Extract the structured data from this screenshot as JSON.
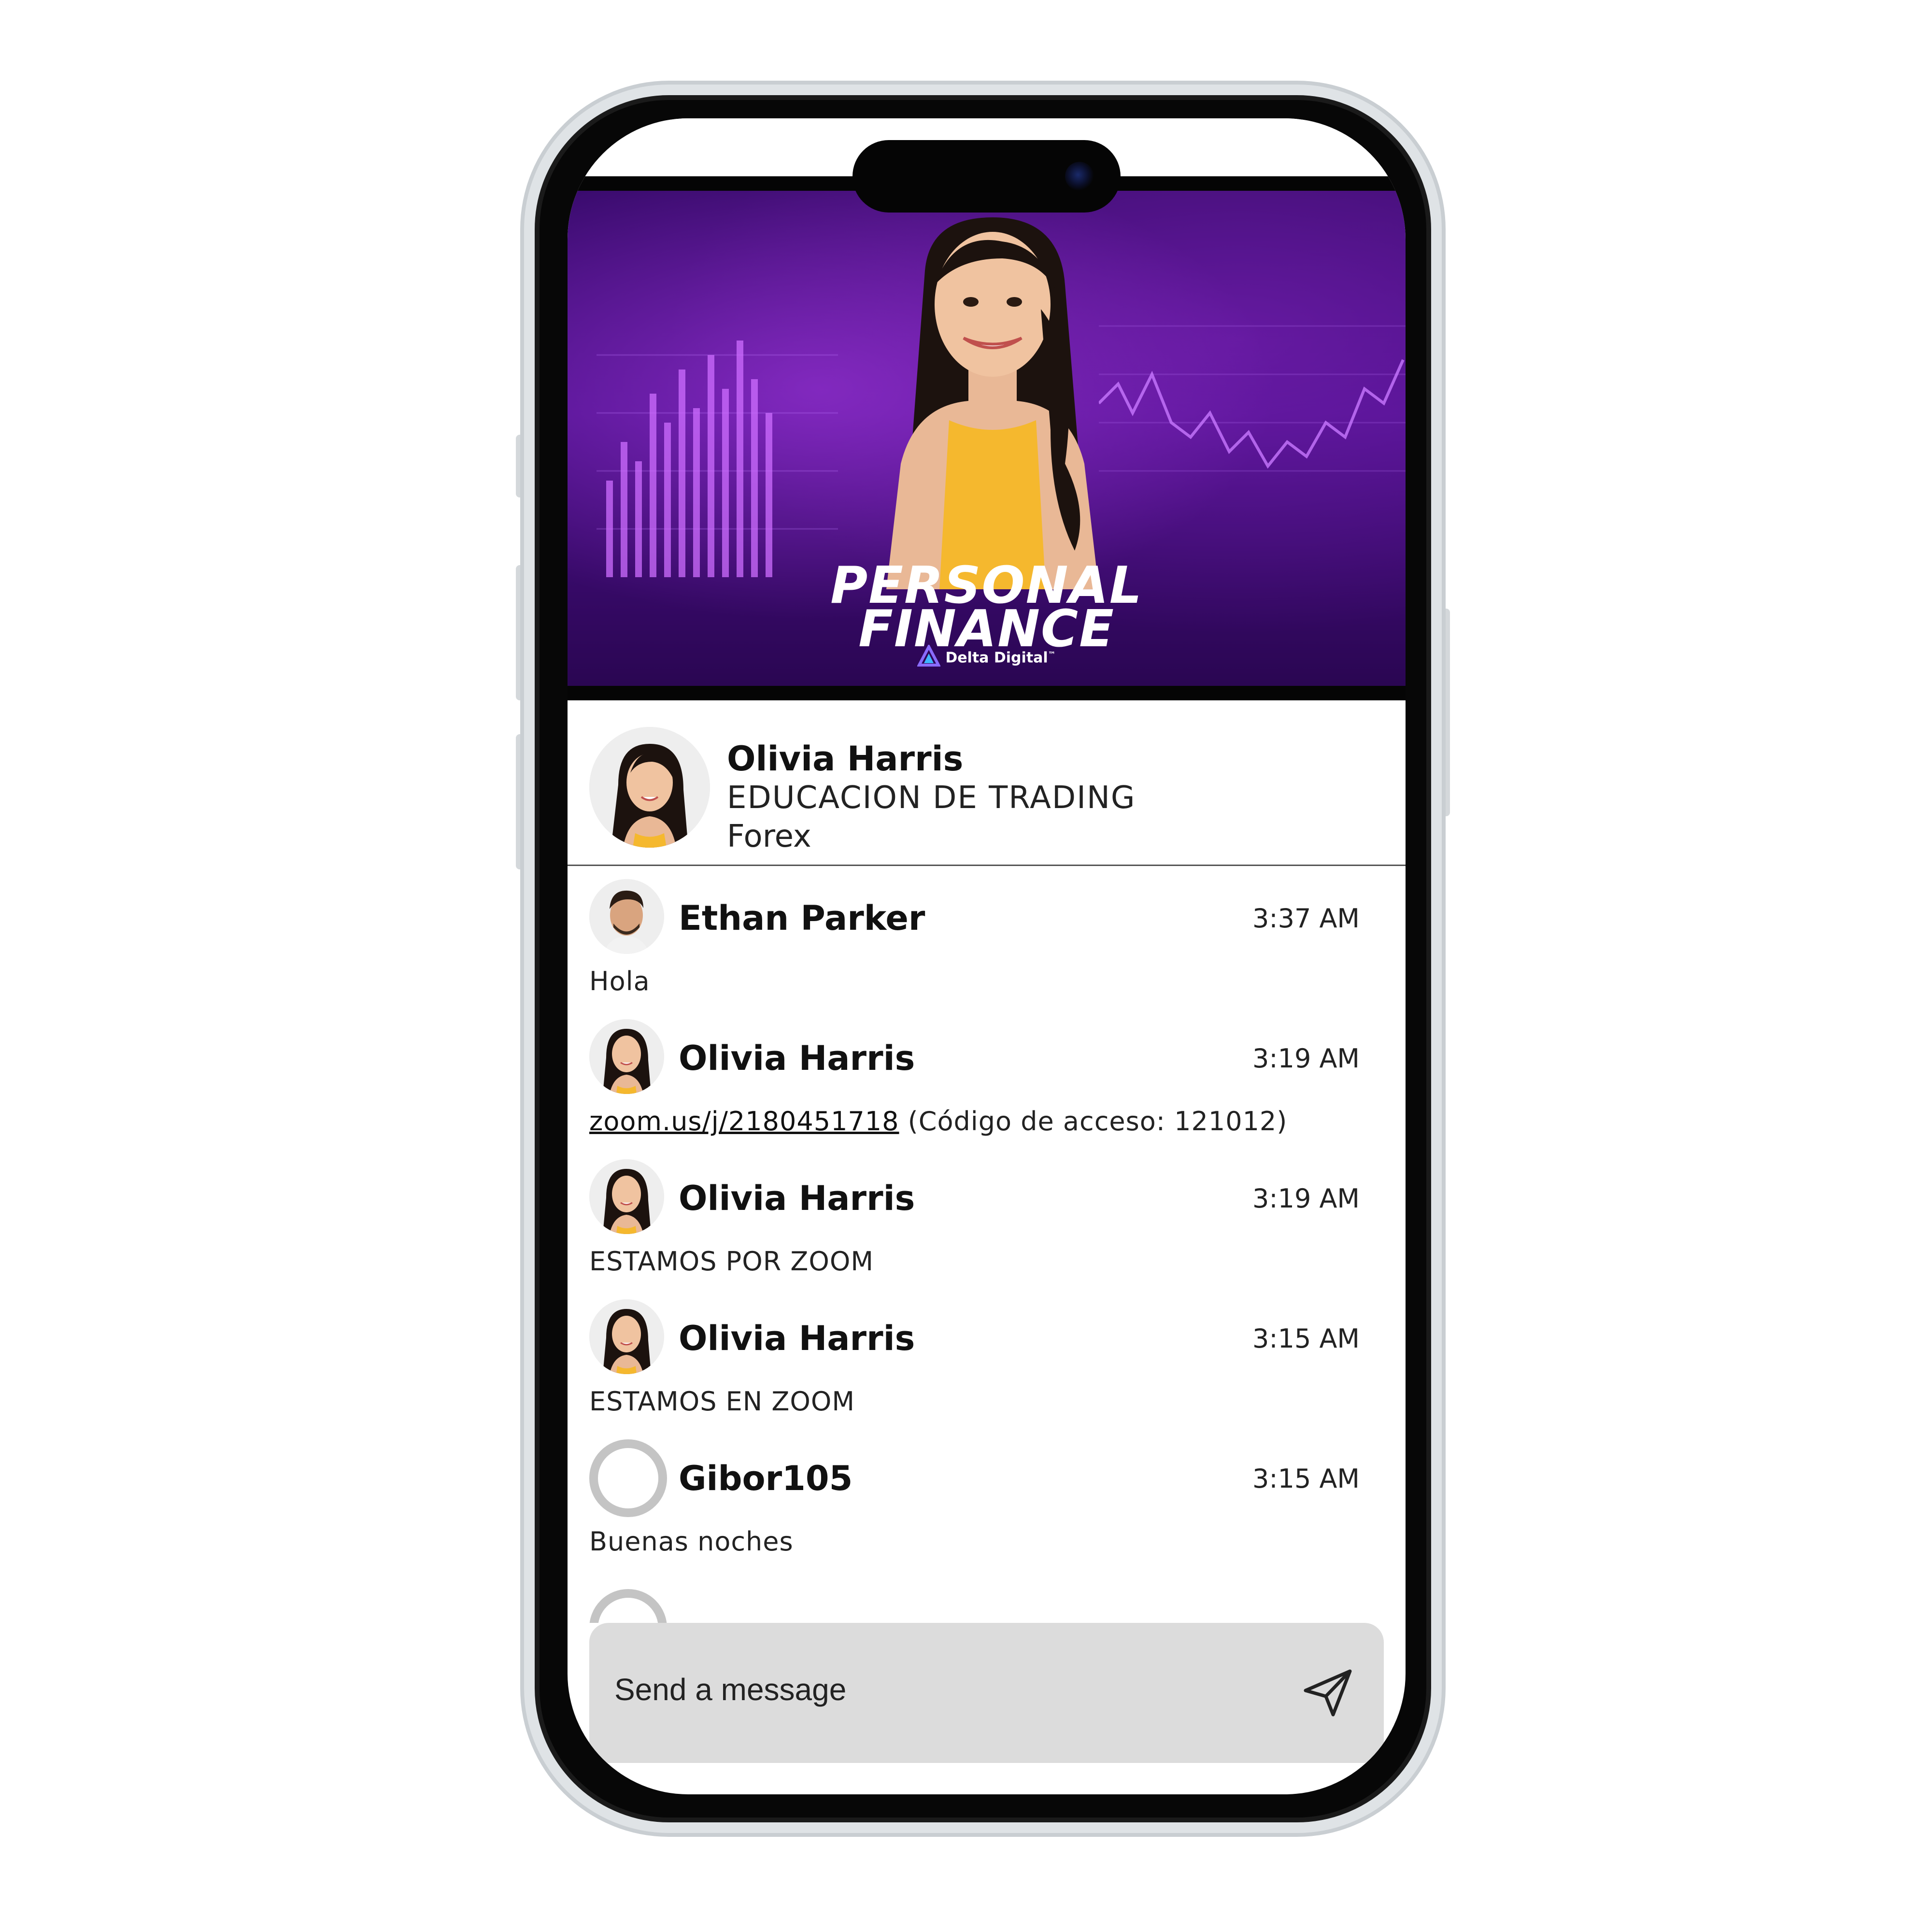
{
  "banner": {
    "title_line1": "PERSONAL",
    "title_line2": "FINANCE",
    "logo_text": "Delta Digital",
    "logo_tm": "™"
  },
  "host": {
    "name": "Olivia Harris",
    "line1": "EDUCACION DE TRADING",
    "line2": "Forex"
  },
  "messages": [
    {
      "author": "Ethan Parker",
      "time": "3:37 AM",
      "text": "Hola",
      "avatar": "photo-man"
    },
    {
      "author": "Olivia Harris",
      "time": "3:19 AM",
      "link": "zoom.us/j/2180451718",
      "text": " (Código de acceso: 121012)",
      "avatar": "photo-woman"
    },
    {
      "author": "Olivia Harris",
      "time": "3:19 AM",
      "text": "ESTAMOS POR ZOOM",
      "avatar": "photo-woman"
    },
    {
      "author": "Olivia Harris",
      "time": "3:15 AM",
      "text": "ESTAMOS EN ZOOM",
      "avatar": "photo-woman"
    },
    {
      "author": "Gibor105",
      "time": "3:15 AM",
      "text": "Buenas noches",
      "avatar": "default-avatar-icon"
    }
  ],
  "composer": {
    "placeholder": "Send a message",
    "send_icon": "send-icon"
  },
  "colors": {
    "banner_purple": "#4b0f8a",
    "composer_bg": "#dcdcdc",
    "avatar_ring": "#c4c4c4"
  }
}
